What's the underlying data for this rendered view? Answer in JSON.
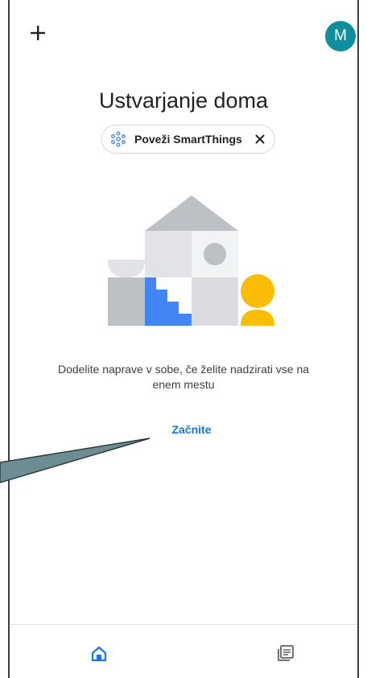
{
  "header": {
    "add_icon": "plus-icon",
    "avatar_initial": "M",
    "avatar_color": "#0f8f9e"
  },
  "main": {
    "title": "Ustvarjanje doma",
    "chip": {
      "label": "Poveži SmartThings",
      "icon": "smartthings-icon",
      "close_icon": "close-icon"
    },
    "description": "Dodelite naprave v sobe, če želite nadzirati vse na enem mestu",
    "cta_label": "Začnite"
  },
  "bottom_nav": {
    "items": [
      {
        "icon": "home-icon",
        "active": true
      },
      {
        "icon": "feed-icon",
        "active": false
      }
    ]
  },
  "colors": {
    "accent": "#1a73e8",
    "house_blue": "#4285f4",
    "figure_yellow": "#fbbc04",
    "house_gray": "#bdc1c6",
    "pointer_fill": "#6e8c93"
  }
}
